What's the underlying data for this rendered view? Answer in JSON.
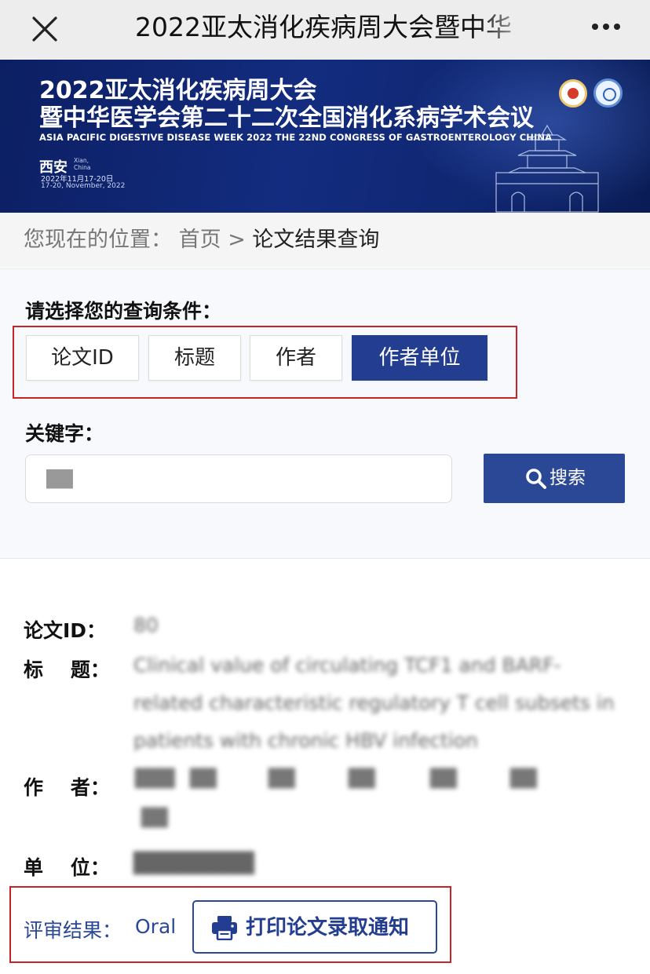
{
  "nav": {
    "title": "2022亚太消化疾病周大会暨中华",
    "close_icon": "close-icon",
    "more_icon": "more-icon"
  },
  "banner": {
    "title_line1": "2022亚太消化疾病周大会",
    "title_line2": "暨中华医学会第二十二次全国消化系病学术会议",
    "subtitle": "ASIA PACIFIC DIGESTIVE DISEASE WEEK 2022 THE 22ND CONGRESS OF GASTROENTEROLOGY CHINA",
    "city": "西安",
    "city_en_1": "Xian,",
    "city_en_2": "China",
    "date_cn": "2022年11月17-20日",
    "date_en": "17-20, November, 2022",
    "colors": {
      "background": "#132c7f",
      "text": "#ffffff"
    }
  },
  "breadcrumb": {
    "prefix": "您现在的位置：",
    "home": "首页",
    "separator": ">",
    "current": "论文结果查询"
  },
  "query": {
    "label": "请选择您的查询条件：",
    "criteria": [
      {
        "label": "论文ID",
        "active": false
      },
      {
        "label": "标题",
        "active": false
      },
      {
        "label": "作者",
        "active": false
      },
      {
        "label": "作者单位",
        "active": true
      }
    ],
    "keyword_label": "关键字：",
    "keyword_value": "██",
    "search_label": "搜索",
    "accent_color": "#233d90"
  },
  "result": {
    "id_label": "论文ID：",
    "id_value": "80",
    "title_label": "标    题：",
    "title_value": "Clinical value of circulating TCF1 and BARF-related characteristic regulatory T cell subsets in patients with chronic HBV infection",
    "author_label": "作    者：",
    "authors": [
      "███",
      "██",
      "██",
      "██",
      "██",
      "██",
      "██"
    ],
    "unit_label": "单    位：",
    "unit_value": "████████",
    "review_label": "评审结果：",
    "review_value": "Oral",
    "print_label": "打印论文录取通知",
    "highlight_color": "#c9232a"
  }
}
